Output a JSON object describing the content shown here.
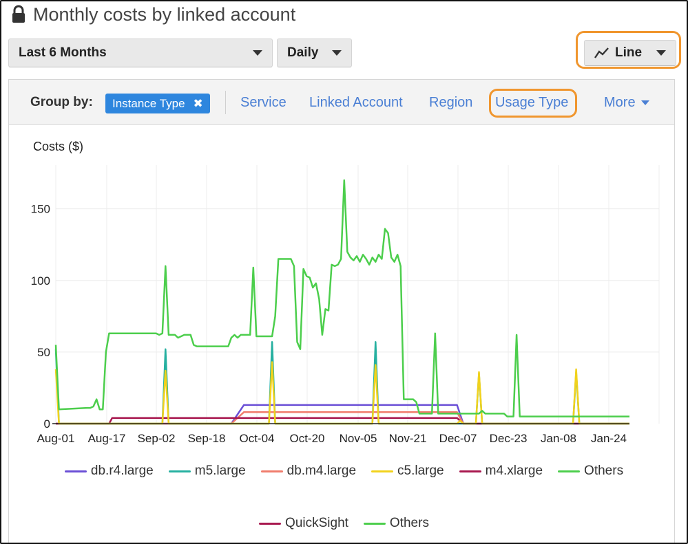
{
  "header": {
    "title": "Monthly costs by linked account",
    "lock_icon": "lock-icon"
  },
  "controls": {
    "range": "Last 6 Months",
    "granularity": "Daily",
    "chart_type": "Line",
    "chart_type_icon": "line-chart-icon"
  },
  "group_by": {
    "label": "Group by:",
    "active_chip": "Instance Type",
    "options": [
      "Service",
      "Linked Account",
      "Region",
      "Usage Type"
    ],
    "more": "More"
  },
  "colors": {
    "accent": "#2e86de",
    "link": "#4a7fd4",
    "highlight": "#f0962e",
    "db_r4_large": "#6a4fd6",
    "m5_large": "#26b0a0",
    "db_m4_large": "#f07c6c",
    "c5_large": "#f2d21c",
    "m4_xlarge": "#a8184f",
    "others": "#4cce4c",
    "quicksight": "#a8184f"
  },
  "chart_data": {
    "type": "line",
    "ylabel": "Costs ($)",
    "ylim": [
      0,
      170
    ],
    "yticks": [
      0,
      50,
      100,
      150
    ],
    "xticks": [
      "Aug-01",
      "Aug-17",
      "Sep-02",
      "Sep-18",
      "Oct-04",
      "Oct-20",
      "Nov-05",
      "Nov-21",
      "Dec-07",
      "Dec-23",
      "Jan-08",
      "Jan-24"
    ],
    "x_range": [
      "Aug-01",
      "Jan-31"
    ],
    "legend_position": "bottom",
    "series": [
      {
        "name": "db.r4.large",
        "color": "#6a4fd6",
        "points": [
          [
            0,
            0
          ],
          [
            56,
            0
          ],
          [
            60,
            13
          ],
          [
            128,
            13
          ],
          [
            130,
            0
          ],
          [
            183,
            0
          ]
        ]
      },
      {
        "name": "m5.large",
        "color": "#26b0a0",
        "points": [
          [
            0,
            52
          ],
          [
            1,
            0
          ],
          [
            34,
            0
          ],
          [
            35,
            52
          ],
          [
            36,
            0
          ],
          [
            68,
            0
          ],
          [
            69,
            57
          ],
          [
            70,
            0
          ],
          [
            101,
            0
          ],
          [
            102,
            57
          ],
          [
            103,
            0
          ],
          [
            134,
            0
          ],
          [
            135,
            35
          ],
          [
            136,
            0
          ],
          [
            165,
            0
          ],
          [
            166,
            36
          ],
          [
            167,
            0
          ],
          [
            183,
            0
          ]
        ]
      },
      {
        "name": "db.m4.large",
        "color": "#f07c6c",
        "points": [
          [
            0,
            0
          ],
          [
            56,
            0
          ],
          [
            60,
            8
          ],
          [
            128,
            8
          ],
          [
            130,
            0
          ],
          [
            183,
            0
          ]
        ]
      },
      {
        "name": "c5.large",
        "color": "#f2d21c",
        "points": [
          [
            0,
            38
          ],
          [
            1,
            0
          ],
          [
            34,
            0
          ],
          [
            35,
            37
          ],
          [
            36,
            0
          ],
          [
            68,
            0
          ],
          [
            69,
            43
          ],
          [
            70,
            0
          ],
          [
            101,
            0
          ],
          [
            102,
            41
          ],
          [
            103,
            0
          ],
          [
            128,
            0
          ],
          [
            129,
            2
          ],
          [
            130,
            0
          ],
          [
            134,
            0
          ],
          [
            135,
            36
          ],
          [
            136,
            0
          ],
          [
            165,
            0
          ],
          [
            166,
            38
          ],
          [
            167,
            0
          ],
          [
            183,
            0
          ]
        ]
      },
      {
        "name": "m4.xlarge",
        "color": "#a8184f",
        "points": [
          [
            0,
            0
          ],
          [
            17,
            0
          ],
          [
            18,
            4
          ],
          [
            56,
            4
          ],
          [
            58,
            4
          ],
          [
            128,
            4
          ],
          [
            130,
            0
          ],
          [
            183,
            0
          ]
        ]
      },
      {
        "name": "Others",
        "color": "#4cce4c",
        "points": [
          [
            0,
            55
          ],
          [
            1,
            10
          ],
          [
            10,
            11
          ],
          [
            11,
            11
          ],
          [
            12,
            12
          ],
          [
            13,
            17
          ],
          [
            14,
            10
          ],
          [
            15,
            10
          ],
          [
            16,
            50
          ],
          [
            17,
            63
          ],
          [
            32,
            63
          ],
          [
            33,
            62
          ],
          [
            34,
            63
          ],
          [
            35,
            110
          ],
          [
            36,
            62
          ],
          [
            38,
            62
          ],
          [
            39,
            60
          ],
          [
            41,
            62
          ],
          [
            43,
            62
          ],
          [
            44,
            55
          ],
          [
            45,
            54
          ],
          [
            55,
            54
          ],
          [
            56,
            60
          ],
          [
            57,
            62
          ],
          [
            58,
            60
          ],
          [
            59,
            62
          ],
          [
            62,
            62
          ],
          [
            63,
            109
          ],
          [
            64,
            61
          ],
          [
            69,
            61
          ],
          [
            70,
            75
          ],
          [
            71,
            115
          ],
          [
            75,
            115
          ],
          [
            76,
            110
          ],
          [
            77,
            57
          ],
          [
            78,
            52
          ],
          [
            79,
            108
          ],
          [
            80,
            103
          ],
          [
            81,
            102
          ],
          [
            82,
            95
          ],
          [
            83,
            98
          ],
          [
            84,
            87
          ],
          [
            85,
            62
          ],
          [
            86,
            80
          ],
          [
            87,
            79
          ],
          [
            88,
            111
          ],
          [
            89,
            110
          ],
          [
            90,
            111
          ],
          [
            91,
            115
          ],
          [
            92,
            170
          ],
          [
            93,
            120
          ],
          [
            94,
            116
          ],
          [
            95,
            114
          ],
          [
            96,
            117
          ],
          [
            97,
            113
          ],
          [
            98,
            118
          ],
          [
            99,
            115
          ],
          [
            100,
            111
          ],
          [
            101,
            116
          ],
          [
            102,
            113
          ],
          [
            103,
            118
          ],
          [
            104,
            115
          ],
          [
            105,
            136
          ],
          [
            106,
            133
          ],
          [
            107,
            116
          ],
          [
            108,
            113
          ],
          [
            109,
            118
          ],
          [
            110,
            110
          ],
          [
            111,
            17
          ],
          [
            114,
            17
          ],
          [
            115,
            15
          ],
          [
            116,
            7
          ],
          [
            120,
            7
          ],
          [
            121,
            63
          ],
          [
            122,
            7
          ],
          [
            124,
            7
          ],
          [
            130,
            7
          ],
          [
            131,
            7
          ],
          [
            135,
            7
          ],
          [
            136,
            9
          ],
          [
            137,
            7
          ],
          [
            143,
            7
          ],
          [
            144,
            5
          ],
          [
            146,
            5
          ],
          [
            147,
            62
          ],
          [
            148,
            5
          ],
          [
            183,
            5
          ]
        ]
      },
      {
        "name": "QuickSight",
        "color": "#a8184f",
        "points": []
      }
    ]
  },
  "legend": {
    "row1": [
      "db.r4.large",
      "m5.large",
      "db.m4.large",
      "c5.large",
      "m4.xlarge",
      "Others"
    ],
    "row2": [
      "QuickSight",
      "Others"
    ]
  }
}
